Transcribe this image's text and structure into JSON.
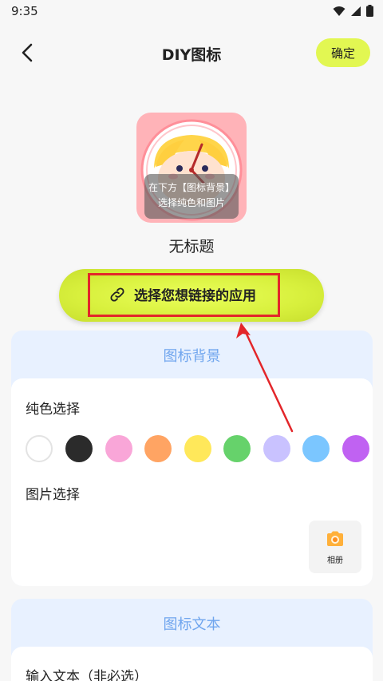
{
  "status_bar": {
    "time": "9:35"
  },
  "nav": {
    "title": "DIY图标",
    "confirm_label": "确定"
  },
  "preview": {
    "overlay_line1": "在下方【图标背景】",
    "overlay_line2": "选择纯色和图片",
    "icon_name": "无标题"
  },
  "link_app": {
    "label": "选择您想链接的应用",
    "icon": "link-icon"
  },
  "background_section": {
    "header": "图标背景",
    "solid_color_label": "纯色选择",
    "colors": [
      "#ffffff",
      "#2b2b2b",
      "#f9a6d8",
      "#ffa463",
      "#ffe85a",
      "#66d26b",
      "#c9c2ff",
      "#7bc6ff",
      "#c062f2"
    ],
    "image_label": "图片选择",
    "album_label": "相册"
  },
  "text_section": {
    "header": "图标文本",
    "input_label": "输入文本（非必选）"
  },
  "accent_color": "#e2f752"
}
